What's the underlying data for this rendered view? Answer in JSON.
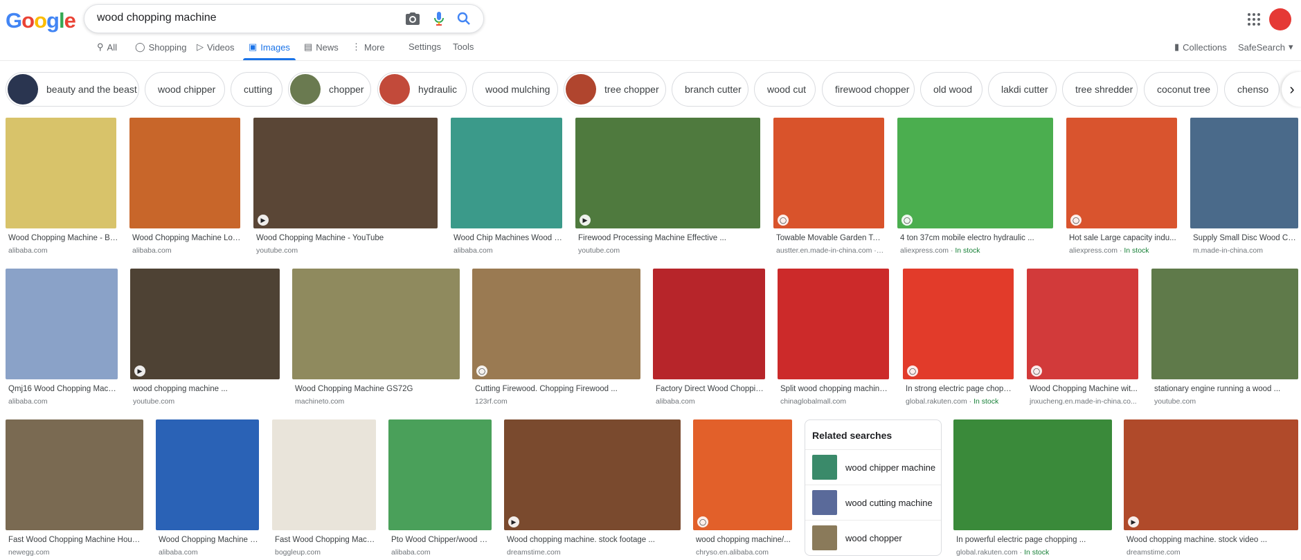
{
  "header": {
    "logo_text": "Google",
    "search_query": "wood chopping machine"
  },
  "tabs": [
    {
      "label": "All",
      "icon": "search-icon"
    },
    {
      "label": "Shopping",
      "icon": "tag-icon"
    },
    {
      "label": "Videos",
      "icon": "play-icon"
    },
    {
      "label": "Images",
      "icon": "image-icon",
      "active": true
    },
    {
      "label": "News",
      "icon": "newspaper-icon"
    },
    {
      "label": "More",
      "icon": "more-icon"
    },
    {
      "label": "Settings"
    },
    {
      "label": "Tools"
    }
  ],
  "right_links": {
    "collections": "Collections",
    "safesearch": "SafeSearch"
  },
  "chips": [
    {
      "label": "beauty and the beast",
      "thumb": "#2a3550"
    },
    {
      "label": "wood chipper"
    },
    {
      "label": "cutting"
    },
    {
      "label": "chopper",
      "thumb": "#6a7a50"
    },
    {
      "label": "hydraulic",
      "thumb": "#c24a3a"
    },
    {
      "label": "wood mulching"
    },
    {
      "label": "tree chopper",
      "thumb": "#b0452e"
    },
    {
      "label": "branch cutter"
    },
    {
      "label": "wood cut"
    },
    {
      "label": "firewood chopper"
    },
    {
      "label": "old wood"
    },
    {
      "label": "lakdi cutter"
    },
    {
      "label": "tree shredder"
    },
    {
      "label": "coconut tree"
    },
    {
      "label": "chenso"
    }
  ],
  "results": [
    {
      "caption": "Wood Chopping Machine - Bu...",
      "source": "alibaba.com",
      "color": "#d8c36a"
    },
    {
      "caption": "Wood Chopping Machine Log...",
      "source": "alibaba.com",
      "color": "#c8662a"
    },
    {
      "caption": "Wood Chopping Machine - YouTube",
      "source": "youtube.com",
      "color": "#5a4636"
    },
    {
      "caption": "Wood Chip Machines Wood C...",
      "source": "alibaba.com",
      "color": "#3b9a8a"
    },
    {
      "caption": "Firewood Processing Machine Effective ...",
      "source": "youtube.com",
      "color": "#4f7a3e"
    },
    {
      "caption": "Towable Movable Garden Too...",
      "source": "austter.en.made-in-china.com · I...",
      "color": "#d9532b"
    },
    {
      "caption": "4 ton 37cm mobile electro hydraulic ...",
      "source": "aliexpress.com",
      "stock": "In stock",
      "color": "#4bae4f"
    },
    {
      "caption": "Hot sale Large capacity indu...",
      "source": "aliexpress.com",
      "stock": "In stock",
      "color": "#d9542e"
    },
    {
      "caption": "Supply Small Disc Wood Cho...",
      "source": "m.made-in-china.com",
      "color": "#4a6a8a"
    },
    {
      "caption": "Qmj16 Wood Chopping Machi...",
      "source": "alibaba.com",
      "color": "#8aa2c8"
    },
    {
      "caption": "wood chopping machine ...",
      "source": "youtube.com",
      "color": "#4e4234"
    },
    {
      "caption": "Wood Chopping Machine GS72G",
      "source": "machineto.com",
      "color": "#8f8a5e"
    },
    {
      "caption": "Cutting Firewood. Chopping Firewood ...",
      "source": "123rf.com",
      "color": "#9a7a52"
    },
    {
      "caption": "Factory Direct Wood Choppin...",
      "source": "alibaba.com",
      "color": "#b7252a"
    },
    {
      "caption": "Split wood chopping machine...",
      "source": "chinaglobalmall.com",
      "color": "#cc2a2a"
    },
    {
      "caption": "In strong electric page choppi...",
      "source": "global.rakuten.com",
      "stock": "In stock",
      "color": "#e23b2a"
    },
    {
      "caption": "Wood Chopping Machine wit...",
      "source": "jnxucheng.en.made-in-china.co...",
      "color": "#d23a3a"
    },
    {
      "caption": "stationary engine running a wood ...",
      "source": "youtube.com",
      "color": "#5f7a4a"
    },
    {
      "caption": "Fast Wood Chopping Machine House...",
      "source": "newegg.com",
      "color": "#7a6a52"
    },
    {
      "caption": "Wood Chopping Machine - ...",
      "source": "alibaba.com",
      "color": "#2a62b6"
    },
    {
      "caption": "Fast Wood Chopping Mach...",
      "source": "boggleup.com",
      "color": "#e9e4da"
    },
    {
      "caption": "Pto Wood Chipper/wood C...",
      "source": "alibaba.com",
      "color": "#4aa05a"
    },
    {
      "caption": "Wood chopping machine. stock footage ...",
      "source": "dreamstime.com",
      "color": "#7a4a2e"
    },
    {
      "caption": "wood chopping machine/...",
      "source": "chryso.en.alibaba.com",
      "color": "#e2602a"
    },
    {
      "caption": "In powerful electric page chopping ...",
      "source": "global.rakuten.com",
      "stock": "In stock",
      "color": "#3a8a3a"
    },
    {
      "caption": "Wood chopping machine. stock video ...",
      "source": "dreamstime.com",
      "color": "#b04a2a"
    }
  ],
  "related": {
    "title": "Related searches",
    "items": [
      {
        "label": "wood chipper machine",
        "thumb": "#3a8a6a"
      },
      {
        "label": "wood cutting machine",
        "thumb": "#5a6a9a"
      },
      {
        "label": "wood chopper",
        "thumb": "#8a7a5a"
      }
    ]
  }
}
